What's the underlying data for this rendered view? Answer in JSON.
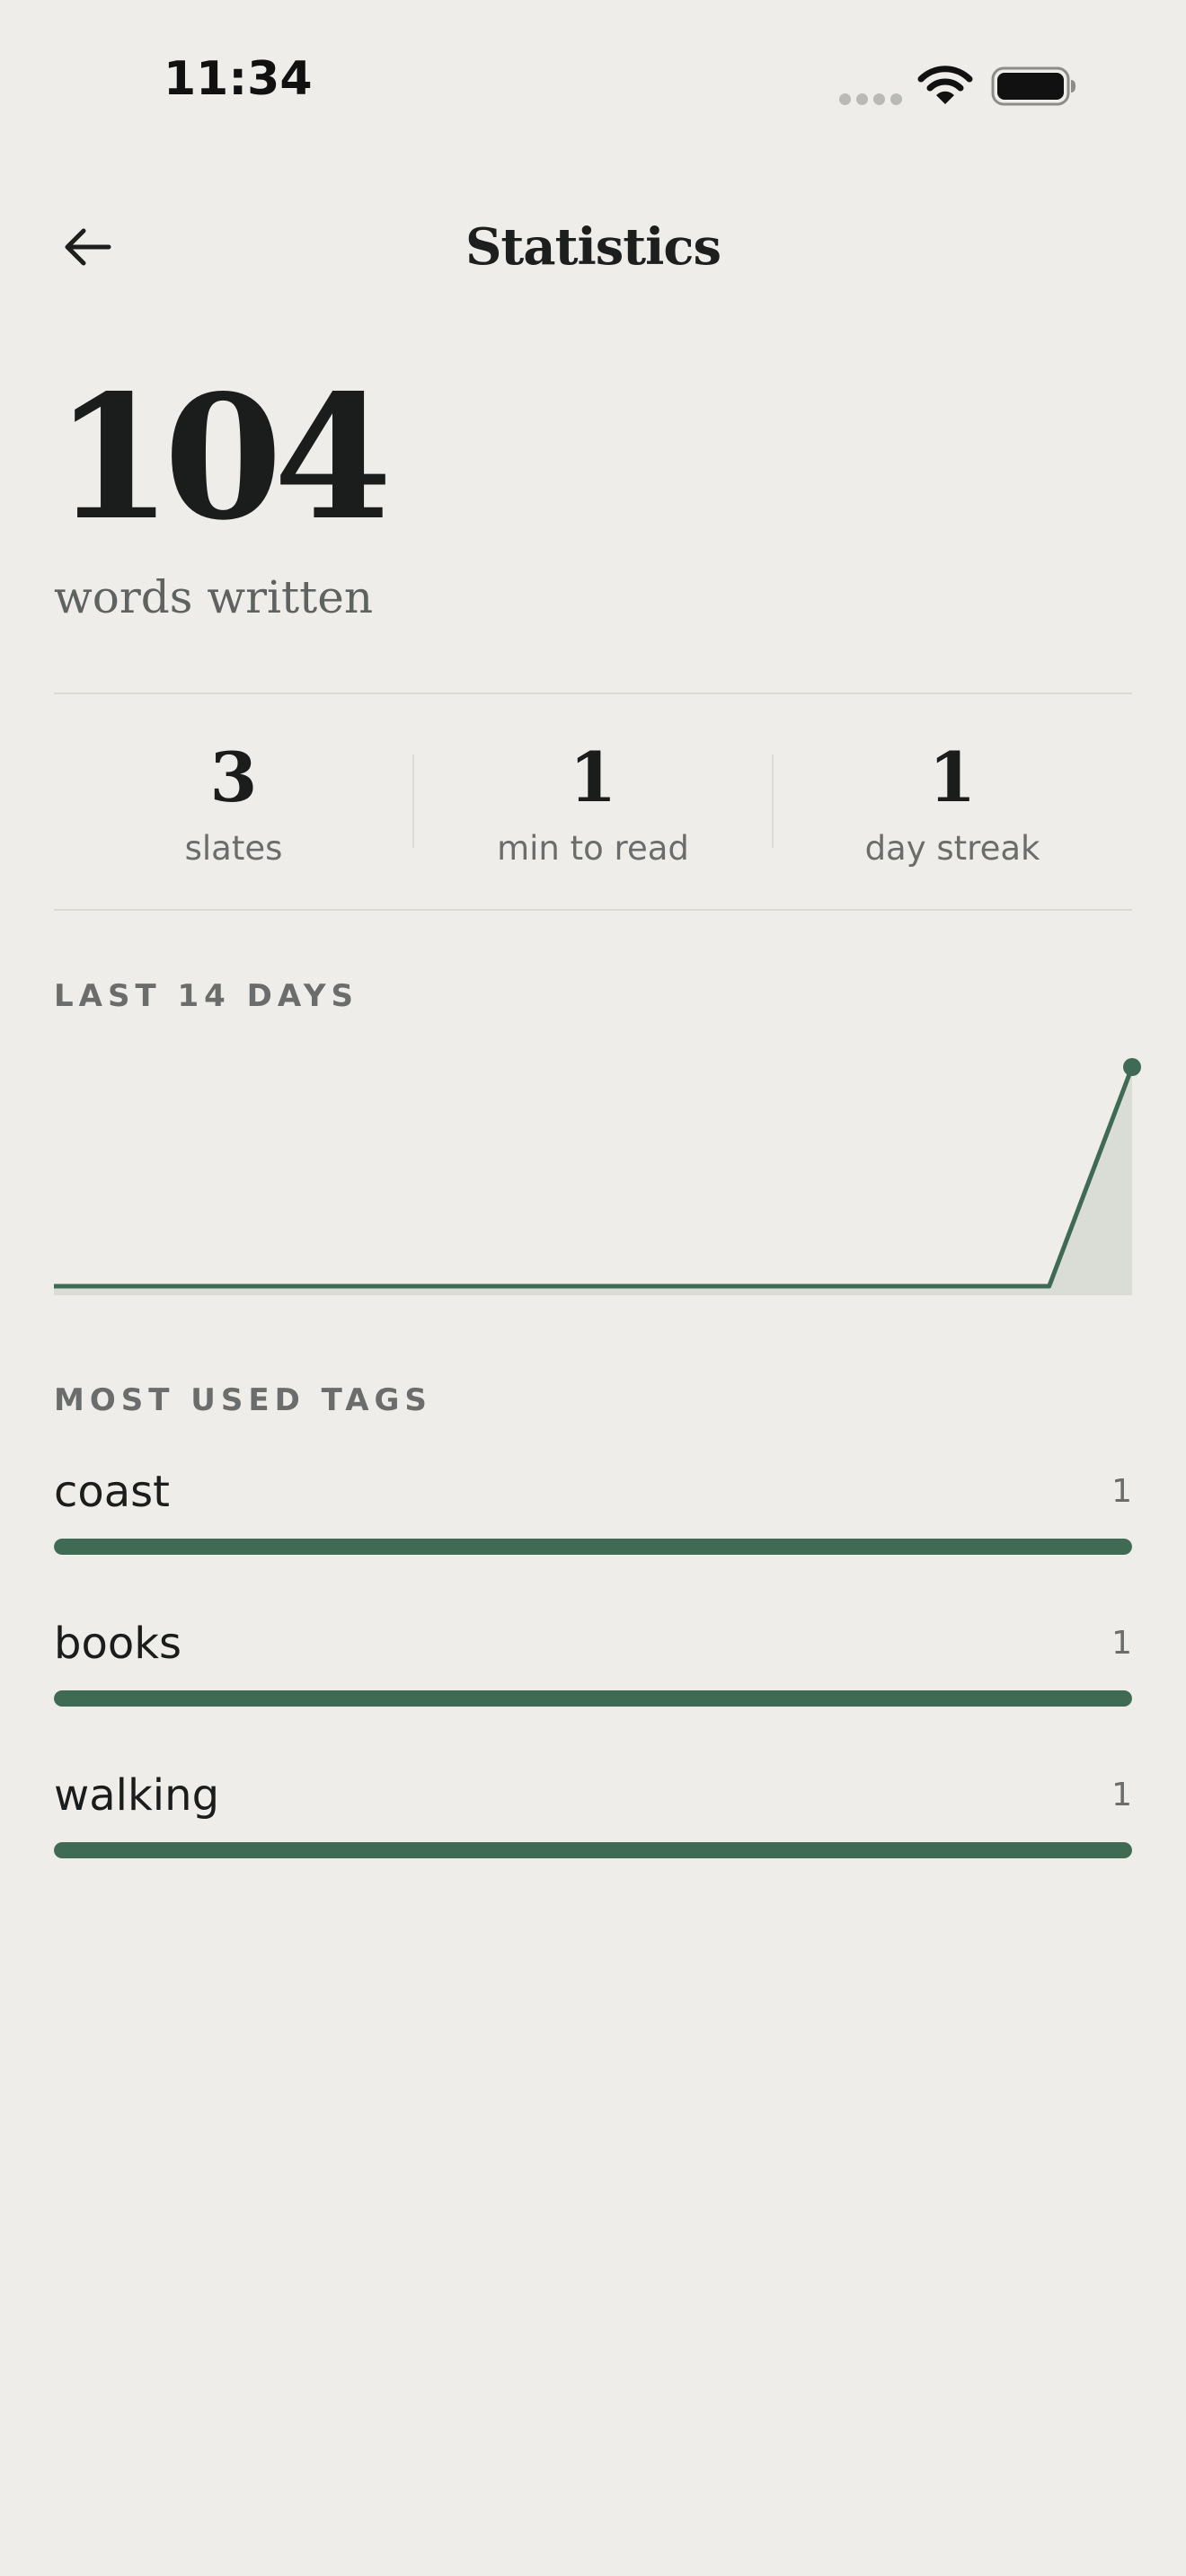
{
  "status_bar": {
    "time": "11:34",
    "icons": [
      "cellular-signal-icon",
      "wifi-icon",
      "battery-icon"
    ]
  },
  "header": {
    "title": "Statistics",
    "back_icon": "arrow-left-icon"
  },
  "summary": {
    "words_value": "104",
    "words_label": "words written"
  },
  "stats": [
    {
      "value": "3",
      "label": "slates"
    },
    {
      "value": "1",
      "label": "min to read"
    },
    {
      "value": "1",
      "label": "day streak"
    }
  ],
  "activity": {
    "label": "LAST 14 DAYS"
  },
  "chart_data": {
    "type": "area",
    "x": [
      1,
      2,
      3,
      4,
      5,
      6,
      7,
      8,
      9,
      10,
      11,
      12,
      13,
      14
    ],
    "values": [
      0,
      0,
      0,
      0,
      0,
      0,
      0,
      0,
      0,
      0,
      0,
      0,
      0,
      104
    ],
    "title": "LAST 14 DAYS",
    "xlabel": "",
    "ylabel": "",
    "ylim": [
      0,
      104
    ],
    "grid": false,
    "legend": "none",
    "color": "#3f6b55"
  },
  "tags": {
    "label": "MOST USED TAGS",
    "items": [
      {
        "name": "coast",
        "count": "1",
        "fraction": 1.0
      },
      {
        "name": "books",
        "count": "1",
        "fraction": 1.0
      },
      {
        "name": "walking",
        "count": "1",
        "fraction": 1.0
      }
    ]
  },
  "colors": {
    "background": "#efede9",
    "accent": "#3f6b55",
    "text": "#1d1f1e",
    "muted": "#6a6d6b",
    "divider": "#dddad5"
  }
}
